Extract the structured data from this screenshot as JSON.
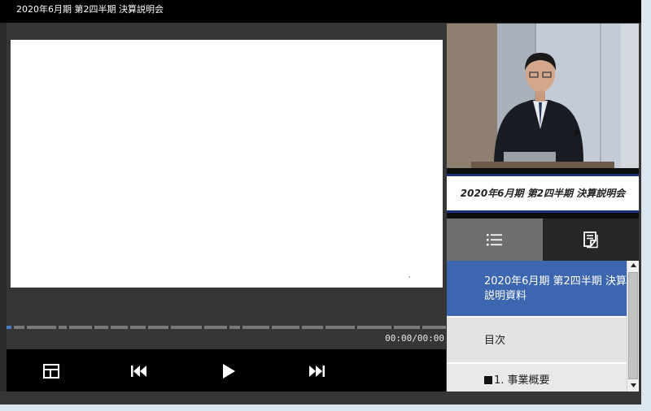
{
  "window": {
    "title": "2020年6月期 第2四半期 決算説明会"
  },
  "player": {
    "time": "00:00/00:00",
    "progress": 0.0,
    "controls": {
      "layout_icon": "layout-icon",
      "prev_icon": "skip-previous-icon",
      "play_icon": "play-icon",
      "next_icon": "skip-next-icon"
    }
  },
  "video": {
    "caption": "2020年6月期 第2四半期 決算説明会"
  },
  "tabs": [
    {
      "name": "toc",
      "icon": "list-icon",
      "active": true
    },
    {
      "name": "notes",
      "icon": "notes-icon",
      "active": false
    }
  ],
  "toc": {
    "items": [
      {
        "label": "2020年6月期 第2四半期 決算説明資料",
        "active": true
      },
      {
        "label": "目次",
        "active": false
      },
      {
        "label": "1. 事業概要",
        "active": false
      }
    ]
  },
  "colors": {
    "accent": "#3d66b0",
    "caption_border": "#1b2f7a",
    "seek_played": "#4d7cc7"
  }
}
